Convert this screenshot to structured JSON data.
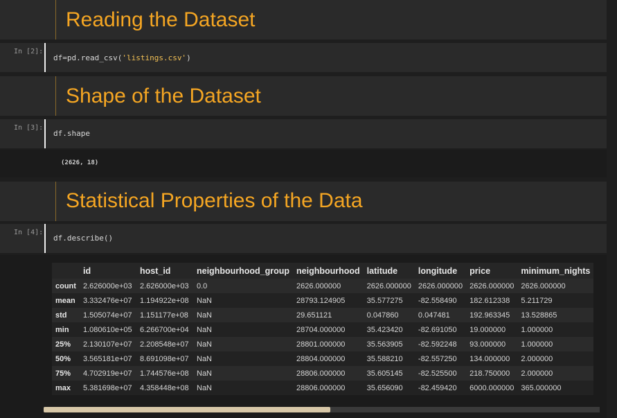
{
  "sections": [
    {
      "heading": "Reading the Dataset"
    },
    {
      "heading": "Shape of the Dataset"
    },
    {
      "heading": "Statistical Properties of the Data"
    }
  ],
  "cells": [
    {
      "prompt": "In [2]:",
      "code_prefix": "df=pd.read_csv(",
      "code_string": "'listings.csv'",
      "code_suffix": ")"
    },
    {
      "prompt": "In [3]:",
      "code": "df.shape",
      "output": "(2626, 18)"
    },
    {
      "prompt": "In [4]:",
      "code": "df.describe()"
    }
  ],
  "table": {
    "columns": [
      "",
      "id",
      "host_id",
      "neighbourhood_group",
      "neighbourhood",
      "latitude",
      "longitude",
      "price",
      "minimum_nights"
    ],
    "rows": [
      [
        "count",
        "2.626000e+03",
        "2.626000e+03",
        "0.0",
        "2626.000000",
        "2626.000000",
        "2626.000000",
        "2626.000000",
        "2626.000000"
      ],
      [
        "mean",
        "3.332476e+07",
        "1.194922e+08",
        "NaN",
        "28793.124905",
        "35.577275",
        "-82.558490",
        "182.612338",
        "5.211729"
      ],
      [
        "std",
        "1.505074e+07",
        "1.151177e+08",
        "NaN",
        "29.651121",
        "0.047860",
        "0.047481",
        "192.963345",
        "13.528865"
      ],
      [
        "min",
        "1.080610e+05",
        "6.266700e+04",
        "NaN",
        "28704.000000",
        "35.423420",
        "-82.691050",
        "19.000000",
        "1.000000"
      ],
      [
        "25%",
        "2.130107e+07",
        "2.208548e+07",
        "NaN",
        "28801.000000",
        "35.563905",
        "-82.592248",
        "93.000000",
        "1.000000"
      ],
      [
        "50%",
        "3.565181e+07",
        "8.691098e+07",
        "NaN",
        "28804.000000",
        "35.588210",
        "-82.557250",
        "134.000000",
        "2.000000"
      ],
      [
        "75%",
        "4.702919e+07",
        "1.744576e+08",
        "NaN",
        "28806.000000",
        "35.605145",
        "-82.525500",
        "218.750000",
        "2.000000"
      ],
      [
        "max",
        "5.381698e+07",
        "4.358448e+08",
        "NaN",
        "28806.000000",
        "35.656090",
        "-82.459420",
        "6000.000000",
        "365.000000"
      ]
    ]
  },
  "colors": {
    "heading": "#f5a623",
    "background": "#1e1e1e",
    "cell": "#2a2a2a"
  }
}
